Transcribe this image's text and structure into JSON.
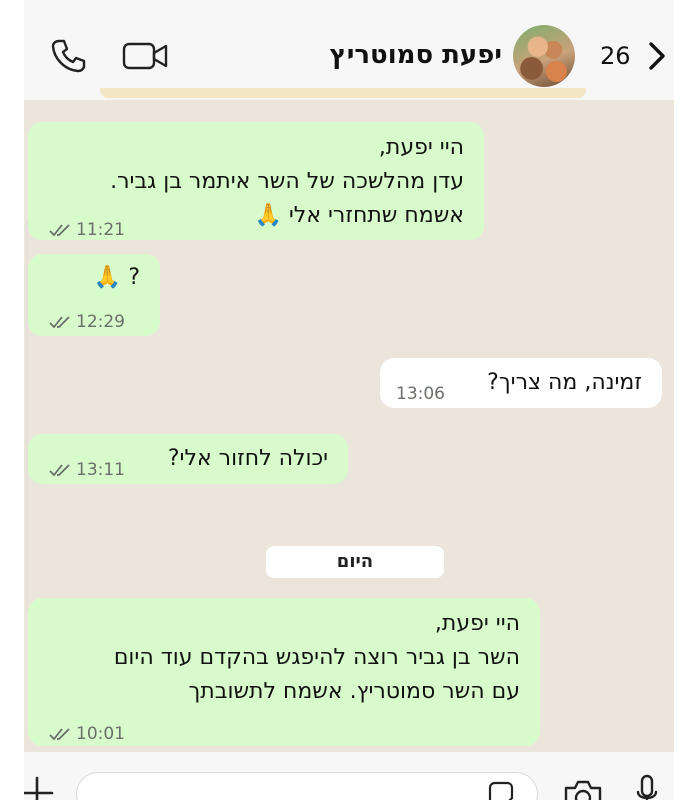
{
  "header": {
    "contact_name": "יפעת סמוטריץ",
    "unread_count": "26"
  },
  "messages": [
    {
      "direction": "incoming",
      "lines": [
        "היי יפעת,",
        "עדן מהלשכה של השר איתמר בן גביר.",
        "אשמח שתחזרי אלי"
      ],
      "emoji_after_last_line": "🙏",
      "time": "11:21",
      "status": "read"
    },
    {
      "direction": "incoming",
      "lines": [
        "?"
      ],
      "emoji_after_last_line": "🙏",
      "time": "12:29",
      "status": "read"
    },
    {
      "direction": "outgoing",
      "lines": [
        "זמינה, מה צריך?"
      ],
      "time": "13:06"
    },
    {
      "direction": "incoming",
      "lines": [
        "יכולה לחזור אלי?"
      ],
      "time": "13:11",
      "status": "read"
    },
    {
      "direction": "incoming",
      "lines": [
        "היי יפעת,",
        "השר בן גביר רוצה להיפגש בהקדם עוד היום",
        "עם השר סמוטריץ. אשמח לתשובתך"
      ],
      "time": "10:01",
      "status": "read"
    }
  ],
  "date_divider": "היום",
  "colors": {
    "incoming_bubble": "#d8fbcc",
    "outgoing_bubble": "#ffffff",
    "chat_background": "#ece5dc",
    "read_ticks": "#6a6f6a"
  },
  "icons": [
    "phone-icon",
    "video-icon",
    "back-icon",
    "plus-icon",
    "sticker-icon",
    "camera-icon",
    "mic-icon"
  ]
}
